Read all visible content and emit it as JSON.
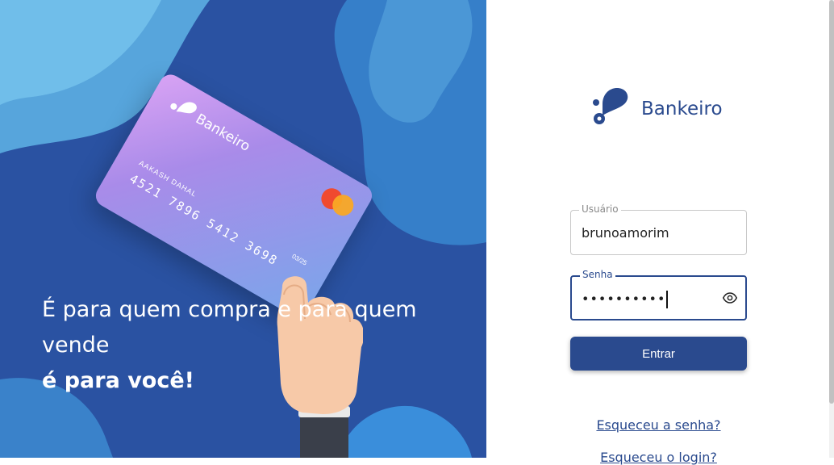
{
  "hero": {
    "line1": "É para quem compra e para quem vende",
    "line2": "é para você!"
  },
  "card": {
    "brand": "Bankeiro",
    "holder": "AAKASH DAHAL",
    "number": "4521 7896 5412 3698",
    "expiry": "03/25"
  },
  "brand": {
    "name": "Bankeiro"
  },
  "form": {
    "username_label": "Usuário",
    "username_value": "brunoamorim",
    "password_label": "Senha",
    "password_value": "••••••••••",
    "submit_label": "Entrar",
    "forgot_password": "Esqueceu a senha?",
    "forgot_login": "Esqueceu o login?"
  },
  "icons": {
    "password_toggle": "eye-icon",
    "logo": "bankeiro-logo-icon"
  },
  "colors": {
    "primary": "#2a4a8e",
    "hero_bg": "#2a52a2"
  }
}
